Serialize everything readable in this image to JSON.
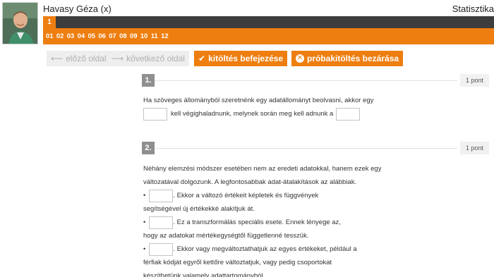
{
  "header": {
    "user_name": "Havasy Géza (x)",
    "course_title": "Statisztika"
  },
  "tabs": {
    "current": "1",
    "questions": [
      "01",
      "02",
      "03",
      "04",
      "05",
      "06",
      "07",
      "08",
      "09",
      "10",
      "11",
      "12"
    ]
  },
  "toolbar": {
    "prev_label": "előző oldal",
    "next_label": "következő oldal",
    "finish_label": "kitöltés befejezése",
    "close_label": "próbakitöltés bezárása"
  },
  "q1": {
    "number": "1.",
    "points": "1 pont",
    "line1": "Ha szöveges állományból szeretnénk egy adatállományt beolvasni, akkor egy",
    "line2_mid": "kell végighaladnunk, melynek során meg kell adnunk a"
  },
  "q2": {
    "number": "2.",
    "points": "1 pont",
    "intro1": "Néhány elemzési módszer esetében nem az eredeti adatokkal, hanem ezek egy",
    "intro2": "változatával dolgozunk. A legfontosabbak adat-átalakítások az alábbiak.",
    "bullet": "•",
    "b1_after": ". Ekkor a változó értékeit képletek és függvények",
    "b1_cont": "segítségével új értékekké alakítjuk át.",
    "b2_after": ". Ez a transzformálás speciális esete. Ennek lényege az,",
    "b2_cont": "hogy az adatokat mértékegységtől függetlenné tesszük.",
    "b3_after": ". Ekkor vagy megváltoztathatjuk az egyes értékeket, például a",
    "b3_cont1": "férfiak kódját egyről kettőre változtatjuk, vagy pedig csoportokat",
    "b3_cont2": "készíthetünk valamely adattartományból."
  },
  "colors": {
    "accent": "#ee7e10",
    "dark_bar": "#3d3d3d",
    "question_badge": "#8f8f8f"
  }
}
